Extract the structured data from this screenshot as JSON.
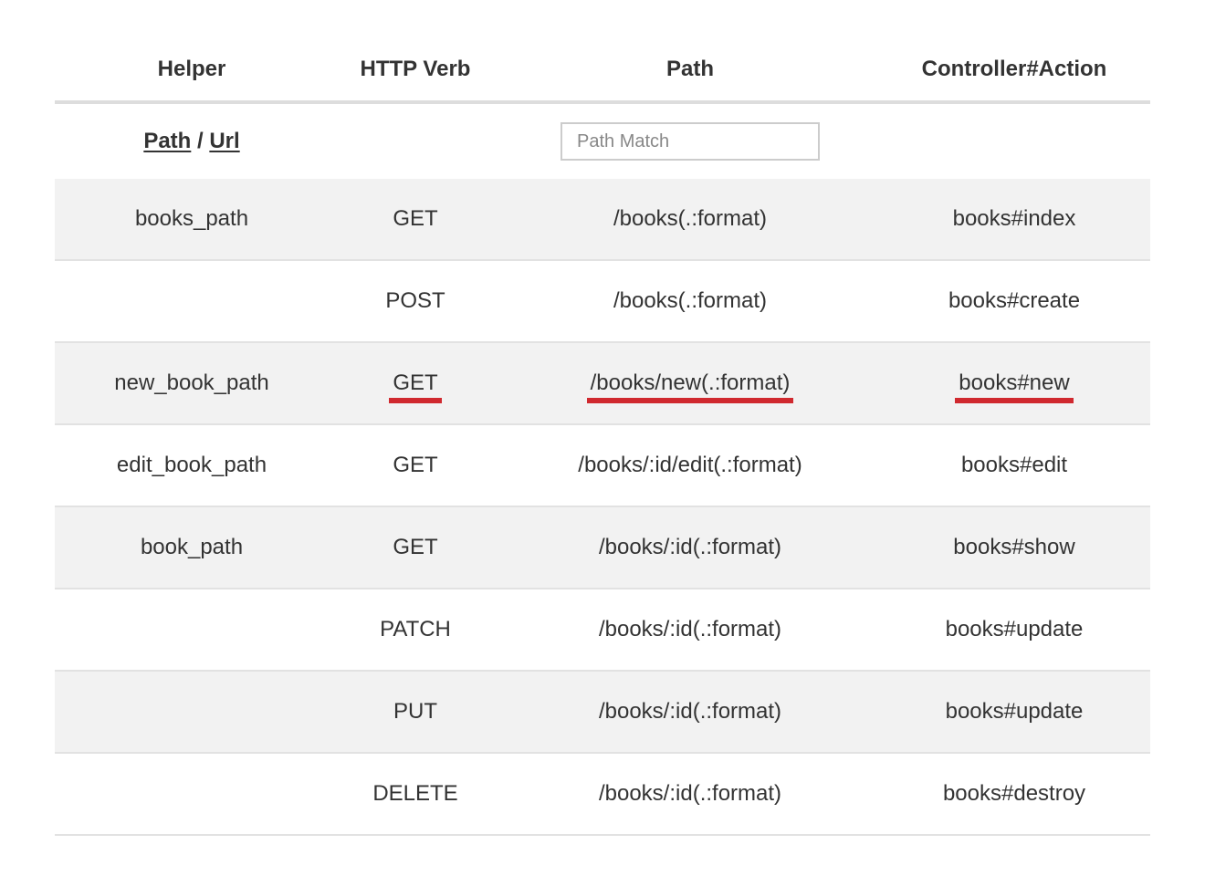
{
  "header": {
    "helper": "Helper",
    "verb": "HTTP Verb",
    "path": "Path",
    "controller_action": "Controller#Action"
  },
  "filter": {
    "path_link": "Path",
    "separator": " / ",
    "url_link": "Url",
    "search_placeholder": "Path Match",
    "search_value": ""
  },
  "routes": [
    {
      "helper": "books_path",
      "verb": "GET",
      "path": "/books(.:format)",
      "action": "books#index",
      "highlighted": false
    },
    {
      "helper": "",
      "verb": "POST",
      "path": "/books(.:format)",
      "action": "books#create",
      "highlighted": false
    },
    {
      "helper": "new_book_path",
      "verb": "GET",
      "path": "/books/new(.:format)",
      "action": "books#new",
      "highlighted": true
    },
    {
      "helper": "edit_book_path",
      "verb": "GET",
      "path": "/books/:id/edit(.:format)",
      "action": "books#edit",
      "highlighted": false
    },
    {
      "helper": "book_path",
      "verb": "GET",
      "path": "/books/:id(.:format)",
      "action": "books#show",
      "highlighted": false
    },
    {
      "helper": "",
      "verb": "PATCH",
      "path": "/books/:id(.:format)",
      "action": "books#update",
      "highlighted": false
    },
    {
      "helper": "",
      "verb": "PUT",
      "path": "/books/:id(.:format)",
      "action": "books#update",
      "highlighted": false
    },
    {
      "helper": "",
      "verb": "DELETE",
      "path": "/books/:id(.:format)",
      "action": "books#destroy",
      "highlighted": false
    }
  ],
  "colors": {
    "highlight_underline": "#d0292f",
    "stripe_background": "#f2f2f2",
    "text": "#333333"
  }
}
